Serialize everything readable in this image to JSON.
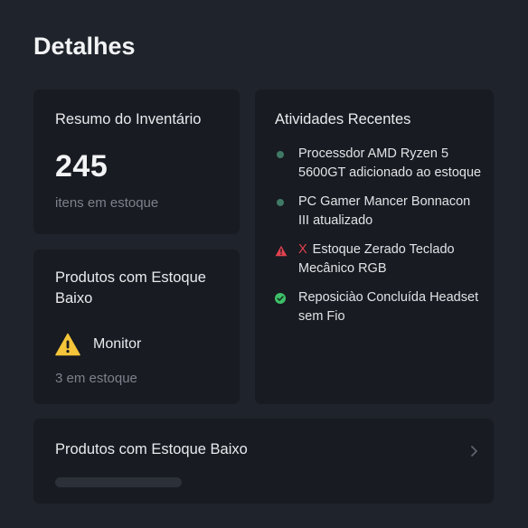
{
  "page": {
    "title": "Detalhes"
  },
  "summary": {
    "title": "Resumo do Inventário",
    "count": "245",
    "subtitle": "itens em estoque"
  },
  "low_stock": {
    "title": "Produtos com Estoque Baixo",
    "item_icon": "warning-triangle-icon",
    "item_label": "Monitor",
    "item_stock": "3 em estoque"
  },
  "activity": {
    "title": "Atividades Recentes",
    "items": [
      {
        "marker": "green-dot",
        "text": "Processdor AMD Ryzen 5 5600GT adicionado ao estoque"
      },
      {
        "marker": "green-dot",
        "text": "PC Gamer Mancer Bonnacon III atualizado"
      },
      {
        "marker": "warning-triangle-icon",
        "prefix": "X",
        "text": "Estoque Zerado Teclado Mecânico RGB"
      },
      {
        "marker": "check-circle-icon",
        "text": "Reposiciào Concluída Headset sem Fio"
      }
    ]
  },
  "bottom": {
    "title": "Produtos com Estoque Baixo",
    "icon": "chevron-right-icon"
  },
  "colors": {
    "background": "#1f232b",
    "card": "#181b21",
    "warning": "#f5c53a",
    "danger": "#e0414f",
    "success": "#3fbf6a",
    "dot": "#3f7a66",
    "muted": "#7b818c"
  }
}
